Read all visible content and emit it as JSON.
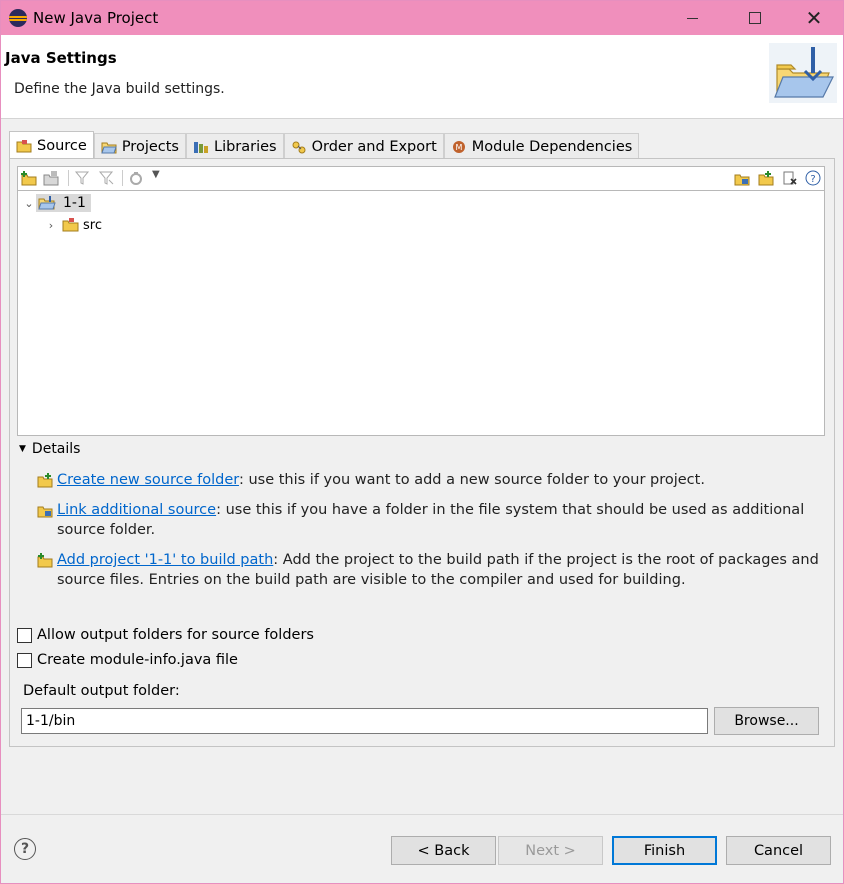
{
  "window": {
    "title": "New Java Project"
  },
  "header": {
    "title": "Java Settings",
    "description": "Define the Java build settings."
  },
  "tabs": [
    {
      "label": "Source",
      "active": true
    },
    {
      "label": "Projects",
      "active": false
    },
    {
      "label": "Libraries",
      "active": false
    },
    {
      "label": "Order and Export",
      "active": false
    },
    {
      "label": "Module Dependencies",
      "active": false
    }
  ],
  "tree": {
    "project": "1-1",
    "folder": "src"
  },
  "details": {
    "label": "Details",
    "items": [
      {
        "link": "Create new source folder",
        "text": ": use this if you want to add a new source folder to your project."
      },
      {
        "link": "Link additional source",
        "text": ": use this if you have a folder in the file system that should be used as additional source folder."
      },
      {
        "link": "Add project '1-1' to build path",
        "text": ": Add the project to the build path if the project is the root of packages and source files. Entries on the build path are visible to the compiler and used for building."
      }
    ]
  },
  "options": {
    "allow_output": "Allow output folders for source folders",
    "create_module_info": "Create module-info.java file"
  },
  "output": {
    "label": "Default output folder:",
    "value": "1-1/bin",
    "browse": "Browse..."
  },
  "buttons": {
    "back": "< Back",
    "next": "Next >",
    "finish": "Finish",
    "cancel": "Cancel",
    "help": "?"
  },
  "colors": {
    "titlebar": "#f08fbc",
    "link": "#0066cc",
    "default_button_border": "#0078d7"
  }
}
